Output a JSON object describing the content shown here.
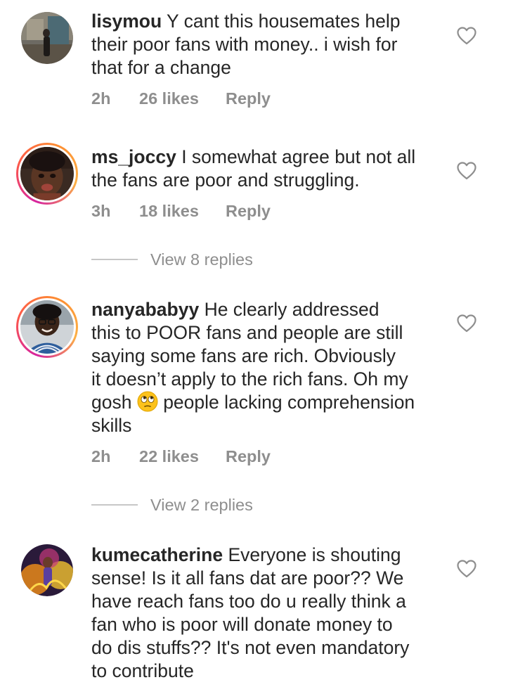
{
  "comments": [
    {
      "username": "lisymou",
      "text": "Y cant this housemates help\ntheir poor fans with money.. i wish for\nthat for a change",
      "time": "2h",
      "likes": "26 likes",
      "reply": "Reply",
      "avatar_icon": "user-photo-avatar",
      "story_ring": false
    },
    {
      "username": "ms_joccy",
      "text": "I somewhat agree but not all\nthe fans are poor and struggling.",
      "time": "3h",
      "likes": "18 likes",
      "reply": "Reply",
      "avatar_icon": "user-photo-avatar",
      "story_ring": true,
      "view_replies": "View 8 replies"
    },
    {
      "username": "nanyababyy",
      "text_before_emoji": "He clearly addressed\nthis to POOR fans and people are still\nsaying some fans are rich. Obviously\nit doesn’t apply to the rich fans. Oh my\ngosh ",
      "emoji": "face-with-rolling-eyes",
      "text_after_emoji": " people lacking comprehension\nskills",
      "time": "2h",
      "likes": "22 likes",
      "reply": "Reply",
      "avatar_icon": "user-photo-avatar",
      "story_ring": true,
      "view_replies": "View 2 replies"
    },
    {
      "username": "kumecatherine",
      "text": "Everyone is shouting\nsense! Is it all fans dat are poor?? We\nhave reach fans too do u really think a\nfan who is poor will donate money to\ndo dis stuffs?? It's not even mandatory\nto contribute",
      "avatar_icon": "user-photo-avatar",
      "story_ring": false
    }
  ],
  "icons": {
    "like": "heart-outline-icon"
  },
  "colors": {
    "text": "#262626",
    "secondary": "#8e8e8e",
    "story_ring_start": "#d6249f",
    "story_ring_end": "#fcb045"
  }
}
